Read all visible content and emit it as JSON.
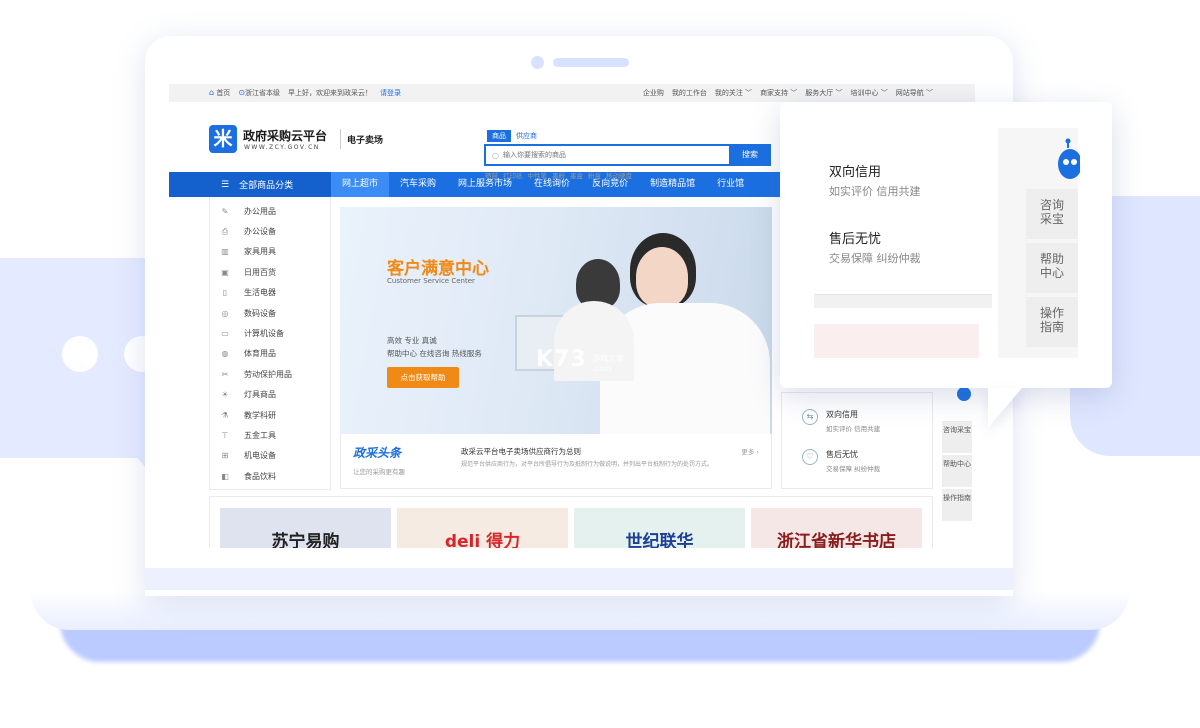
{
  "topbar": {
    "home": "首页",
    "location": "浙江省本级",
    "greeting": "早上好，欢迎来到政采云！",
    "login": "请登录",
    "links": [
      "企业购",
      "我的工作台",
      "我的关注 ﹀",
      "商家支持 ﹀",
      "服务大厅 ﹀",
      "培训中心 ﹀",
      "网站导航 ﹀"
    ]
  },
  "header": {
    "logo_char": "米",
    "logo_title": "政府采购云平台",
    "logo_sub": "WWW.ZCY.GOV.CN",
    "market": "电子卖场",
    "search_tabs": [
      "商品",
      "供应商"
    ],
    "search_placeholder": "输入你要搜索的商品",
    "search_button": "搜索",
    "hot_words": [
      "硒鼓",
      "打印纸",
      "中性笔",
      "墨粉",
      "墨盒",
      "粉盒",
      "移动硬盘"
    ]
  },
  "nav": {
    "all_categories": "全部商品分类",
    "items": [
      "网上超市",
      "汽车采购",
      "网上服务市场",
      "在线询价",
      "反向竞价",
      "制造精品馆",
      "行业馆"
    ]
  },
  "categories": [
    "办公用品",
    "办公设备",
    "家具用具",
    "日用百货",
    "生活电器",
    "数码设备",
    "计算机设备",
    "体育用品",
    "劳动保护用品",
    "灯具商品",
    "教学科研",
    "五金工具",
    "机电设备",
    "食品饮料"
  ],
  "category_icons": [
    "pen-icon",
    "printer-icon",
    "furniture-icon",
    "bag-icon",
    "appliance-icon",
    "camera-icon",
    "computer-icon",
    "ball-icon",
    "tools-icon",
    "lamp-icon",
    "lab-icon",
    "hardware-icon",
    "machine-icon",
    "food-icon"
  ],
  "banner": {
    "title": "客户满意中心",
    "subtitle_en": "Customer Service Center",
    "line1": "高效 专业 真诚",
    "line2": "帮助中心 在线咨询 热线服务",
    "button": "点击获取帮助"
  },
  "watermark": {
    "main": "K73",
    "sub": "游戏之家",
    "domain": ".com"
  },
  "news": {
    "logo": "政采头条",
    "subtitle": "让您的采购更有趣",
    "title": "政采云平台电子卖场供应商行为总则",
    "more": "更多 ›",
    "desc": "规范平台供应商行为，对平台所倡导行为及抵制行为做说明，并列出平台抵制行为的处罚方式。"
  },
  "side_panel": [
    {
      "title": "双向信用",
      "sub": "如实评价 信用共建"
    },
    {
      "title": "售后无忧",
      "sub": "交易保障 纠纷仲裁"
    }
  ],
  "mini_buttons": [
    "咨询采宝",
    "帮助中心",
    "操作指南"
  ],
  "brands": [
    {
      "name": "苏宁易购",
      "bg": "#dfe3ef",
      "color": "#222222"
    },
    {
      "name": "deli 得力",
      "bg": "#f6ebe3",
      "color": "#d7262b"
    },
    {
      "name": "世纪联华",
      "bg": "#e4f1ef",
      "color": "#1c3f95"
    },
    {
      "name": "浙江省新华书店",
      "bg": "#f5e7e5",
      "color": "#8a1c1c"
    }
  ],
  "popup": {
    "items": [
      {
        "title": "双向信用",
        "sub": "如实评价 信用共建"
      },
      {
        "title": "售后无忧",
        "sub": "交易保障 纠纷仲裁"
      }
    ],
    "side_buttons": [
      "咨询\n采宝",
      "帮助\n中心",
      "操作\n指南"
    ]
  },
  "colors": {
    "primary": "#1b6fe0",
    "accent": "#f08a16",
    "bg_bubble": "#e4eaff"
  }
}
